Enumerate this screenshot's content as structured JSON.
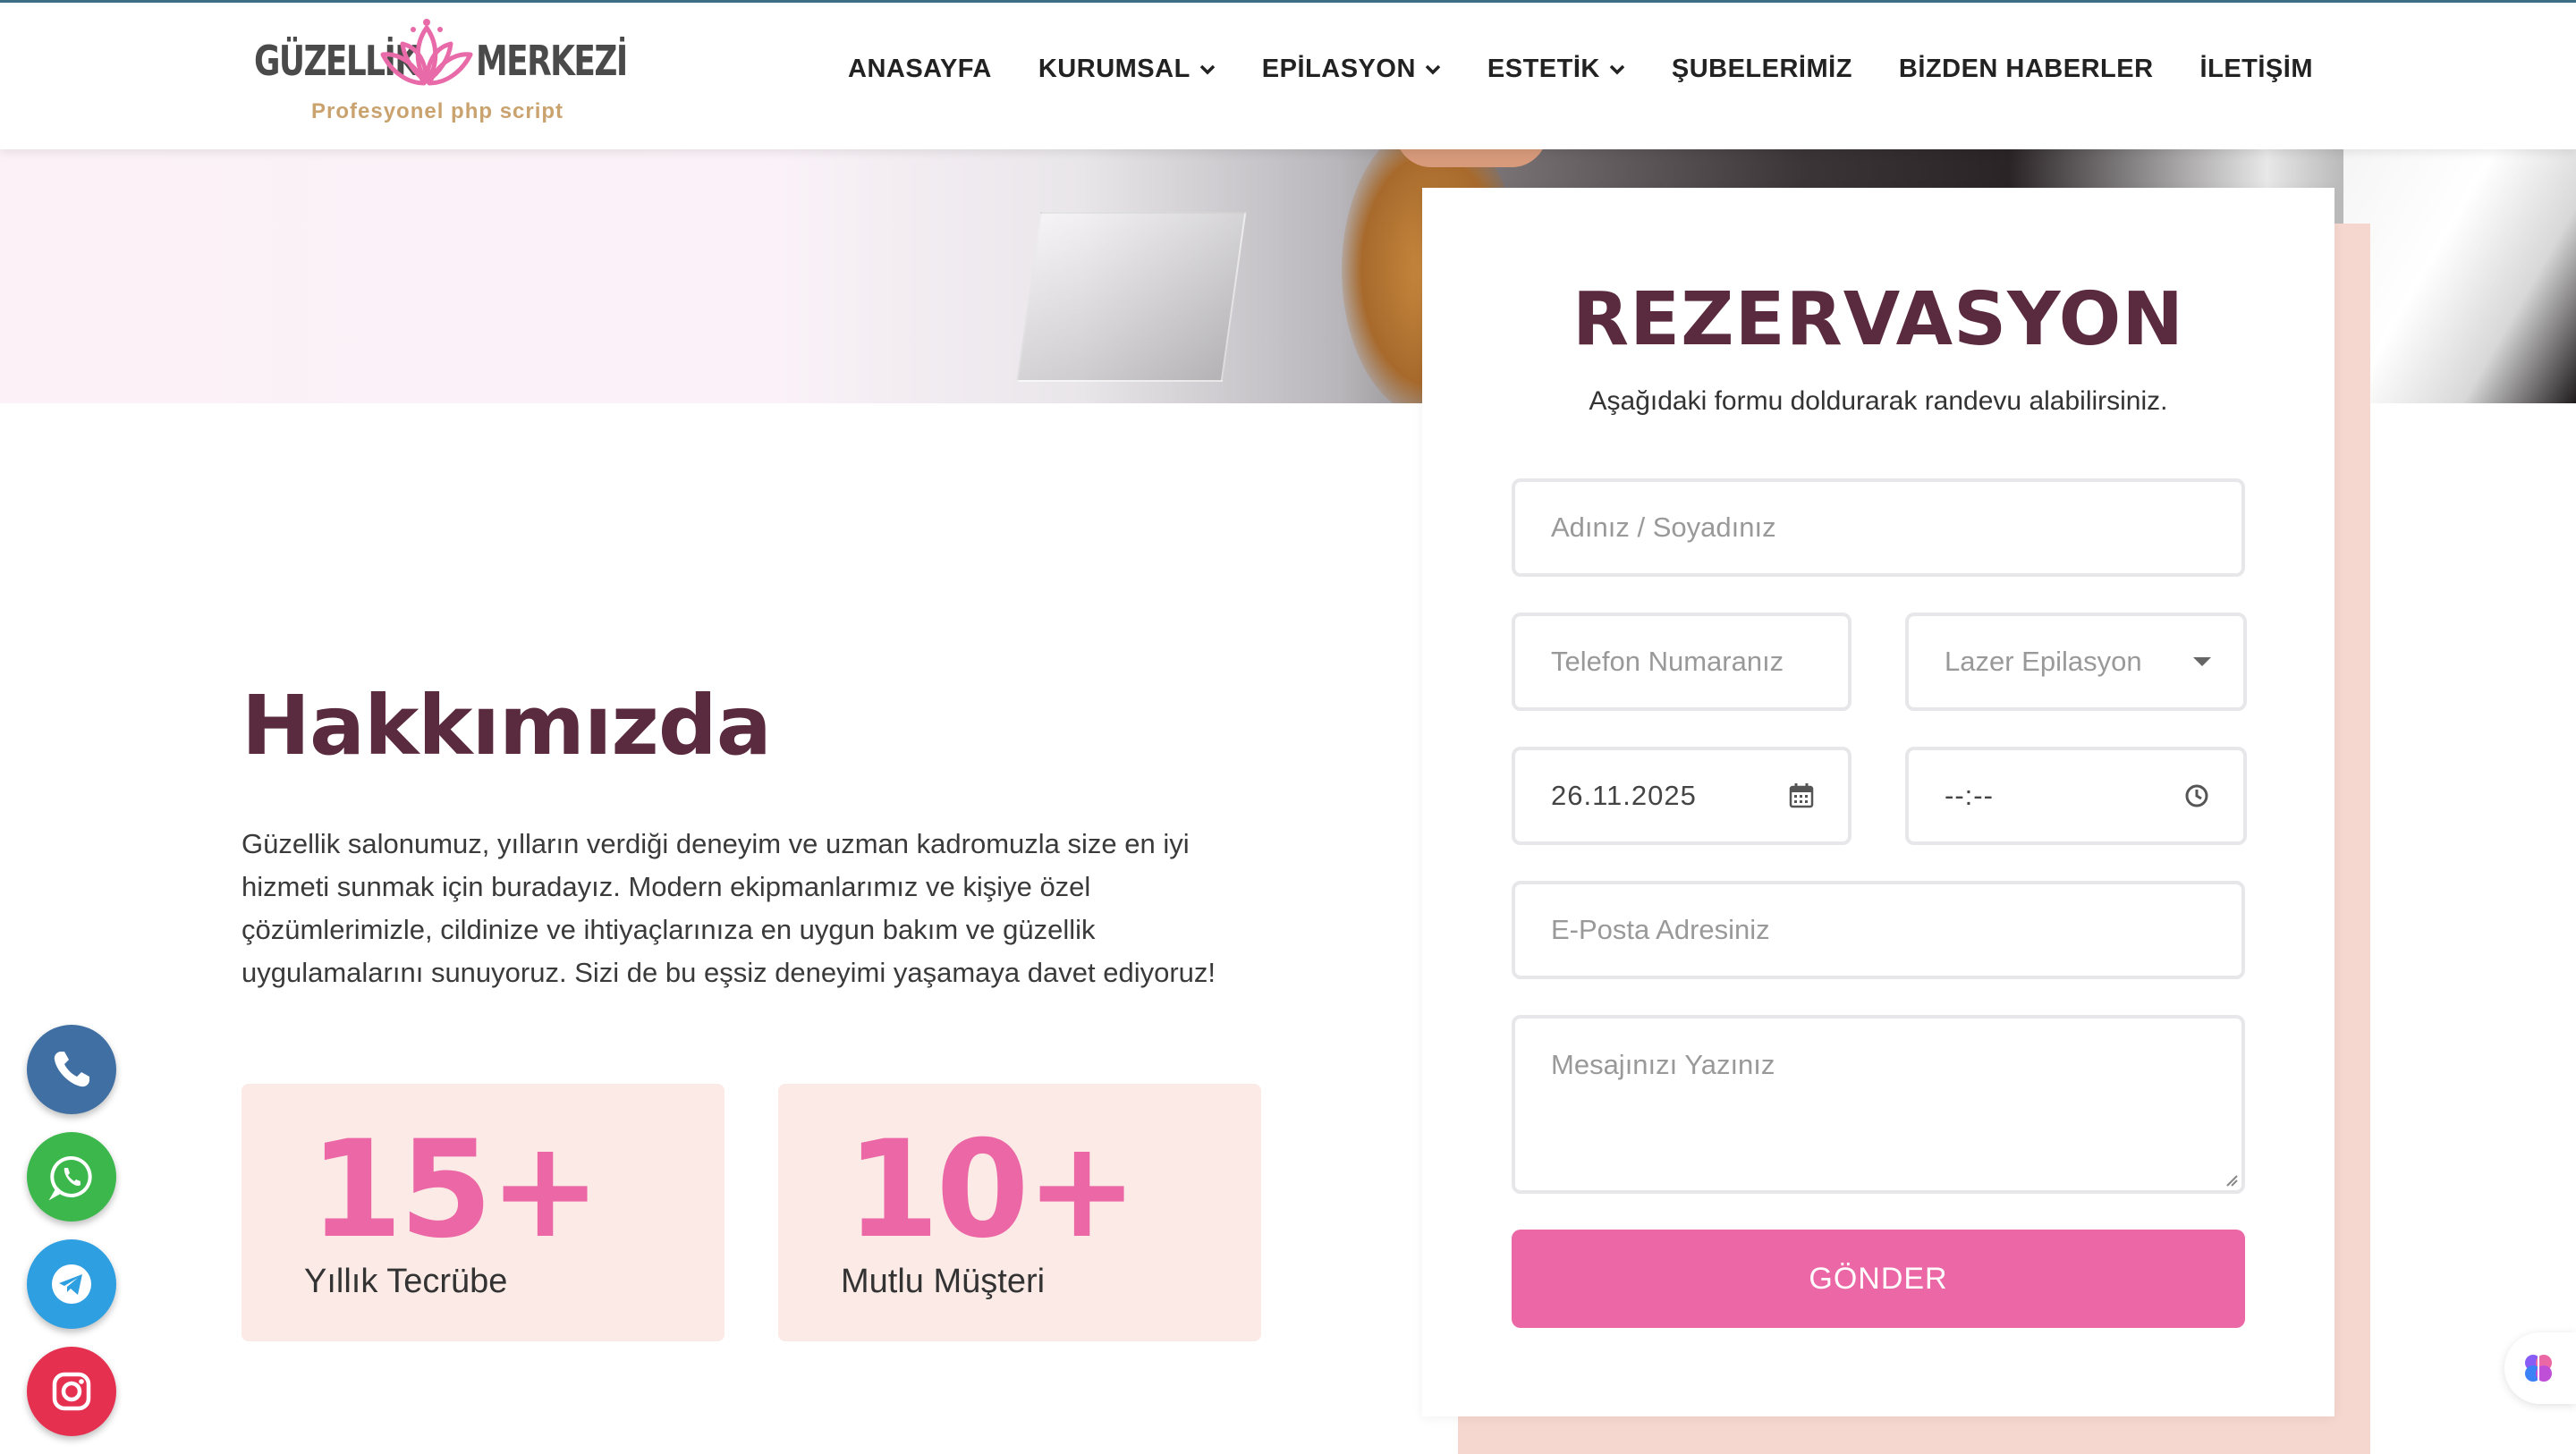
{
  "brand": {
    "word_left": "GÜZELLİK",
    "word_right": "MERKEZİ",
    "tagline": "Profesyonel php script",
    "accent": "#ec67a5",
    "dark": "#5a2a3e",
    "gold": "#c9a26e"
  },
  "nav": {
    "items": [
      {
        "label": "ANASAYFA",
        "has_dropdown": false
      },
      {
        "label": "KURUMSAL",
        "has_dropdown": true
      },
      {
        "label": "EPİLASYON",
        "has_dropdown": true
      },
      {
        "label": "ESTETİK",
        "has_dropdown": true
      },
      {
        "label": "ŞUBELERİMİZ",
        "has_dropdown": false
      },
      {
        "label": "BİZDEN HABERLER",
        "has_dropdown": false
      },
      {
        "label": "İLETİŞİM",
        "has_dropdown": false
      }
    ]
  },
  "about": {
    "title": "Hakkımızda",
    "text": "Güzellik salonumuz, yılların verdiği deneyim ve uzman kadromuzla size en iyi hizmeti sunmak için buradayız. Modern ekipmanlarımız ve kişiye özel çözümlerimizle, cildinize ve ihtiyaçlarınıza en uygun bakım ve güzellik uygulamalarını sunuyoruz. Sizi de bu eşsiz deneyimi yaşamaya davet ediyoruz!",
    "stats": [
      {
        "number": "15+",
        "label": "Yıllık Tecrübe"
      },
      {
        "number": "10+",
        "label": "Mutlu Müşteri"
      }
    ]
  },
  "reservation": {
    "title": "REZERVASYON",
    "subtitle": "Aşağıdaki formu doldurarak randevu alabilirsiniz.",
    "name_placeholder": "Adınız / Soyadınız",
    "phone_placeholder": "Telefon Numaranız",
    "service_selected": "Lazer Epilasyon",
    "date_value": "26.11.2025",
    "time_value": "--:--",
    "email_placeholder": "E-Posta Adresiniz",
    "message_placeholder": "Mesajınızı Yazınız",
    "submit_label": "GÖNDER"
  },
  "socials": [
    {
      "name": "phone-icon",
      "color": "#3f6fa3"
    },
    {
      "name": "whatsapp-icon",
      "color": "#3cb74c"
    },
    {
      "name": "telegram-icon",
      "color": "#2e9fe0"
    },
    {
      "name": "instagram-icon",
      "color": "#e5314f"
    }
  ]
}
